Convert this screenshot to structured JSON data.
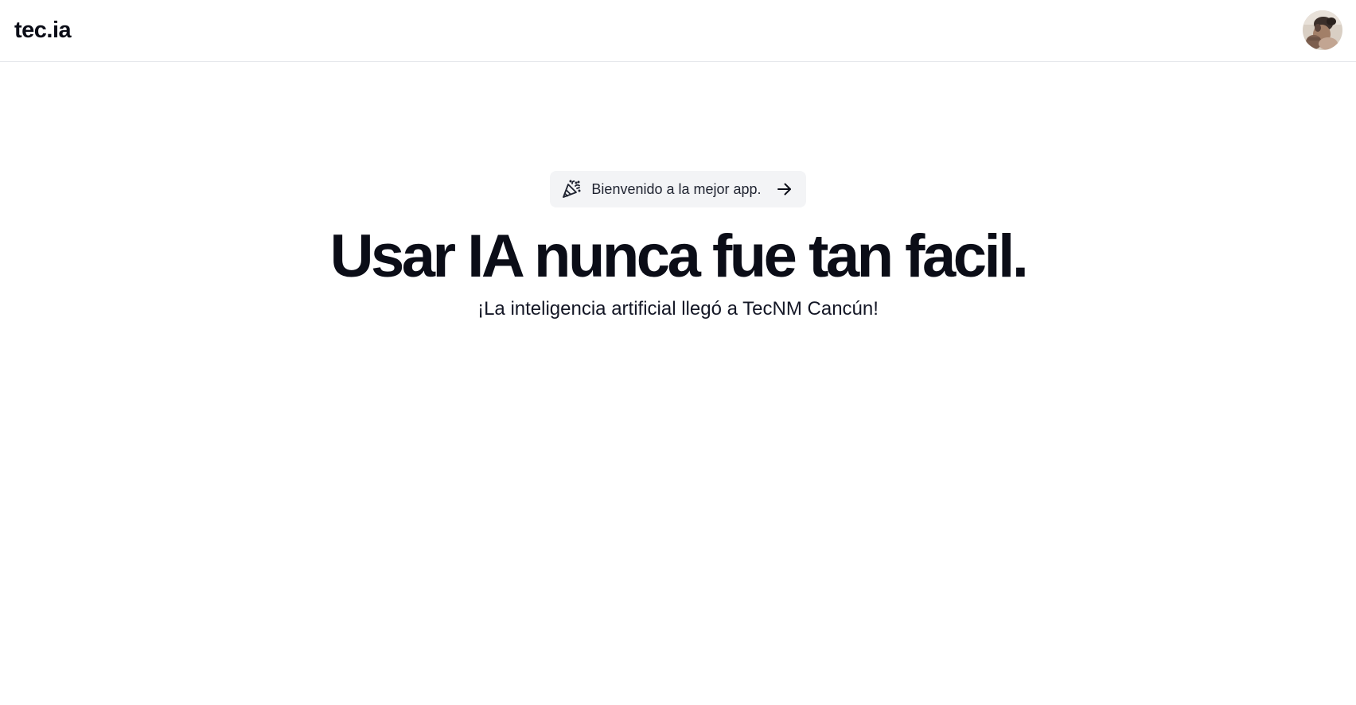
{
  "header": {
    "brand": "tec.ia",
    "avatar_icon": "user-avatar-icon"
  },
  "hero": {
    "announcement": {
      "icon": "party-popper-icon",
      "label": "Bienvenido a la mejor app.",
      "arrow_icon": "arrow-right-icon"
    },
    "headline": "Usar IA nunca fue tan facil.",
    "subheadline": "¡La inteligencia artificial llegó a TecNM Cancún!"
  },
  "colors": {
    "text": "#0b0d17",
    "pill_background": "#f3f4f6",
    "divider": "#e5e7eb"
  }
}
